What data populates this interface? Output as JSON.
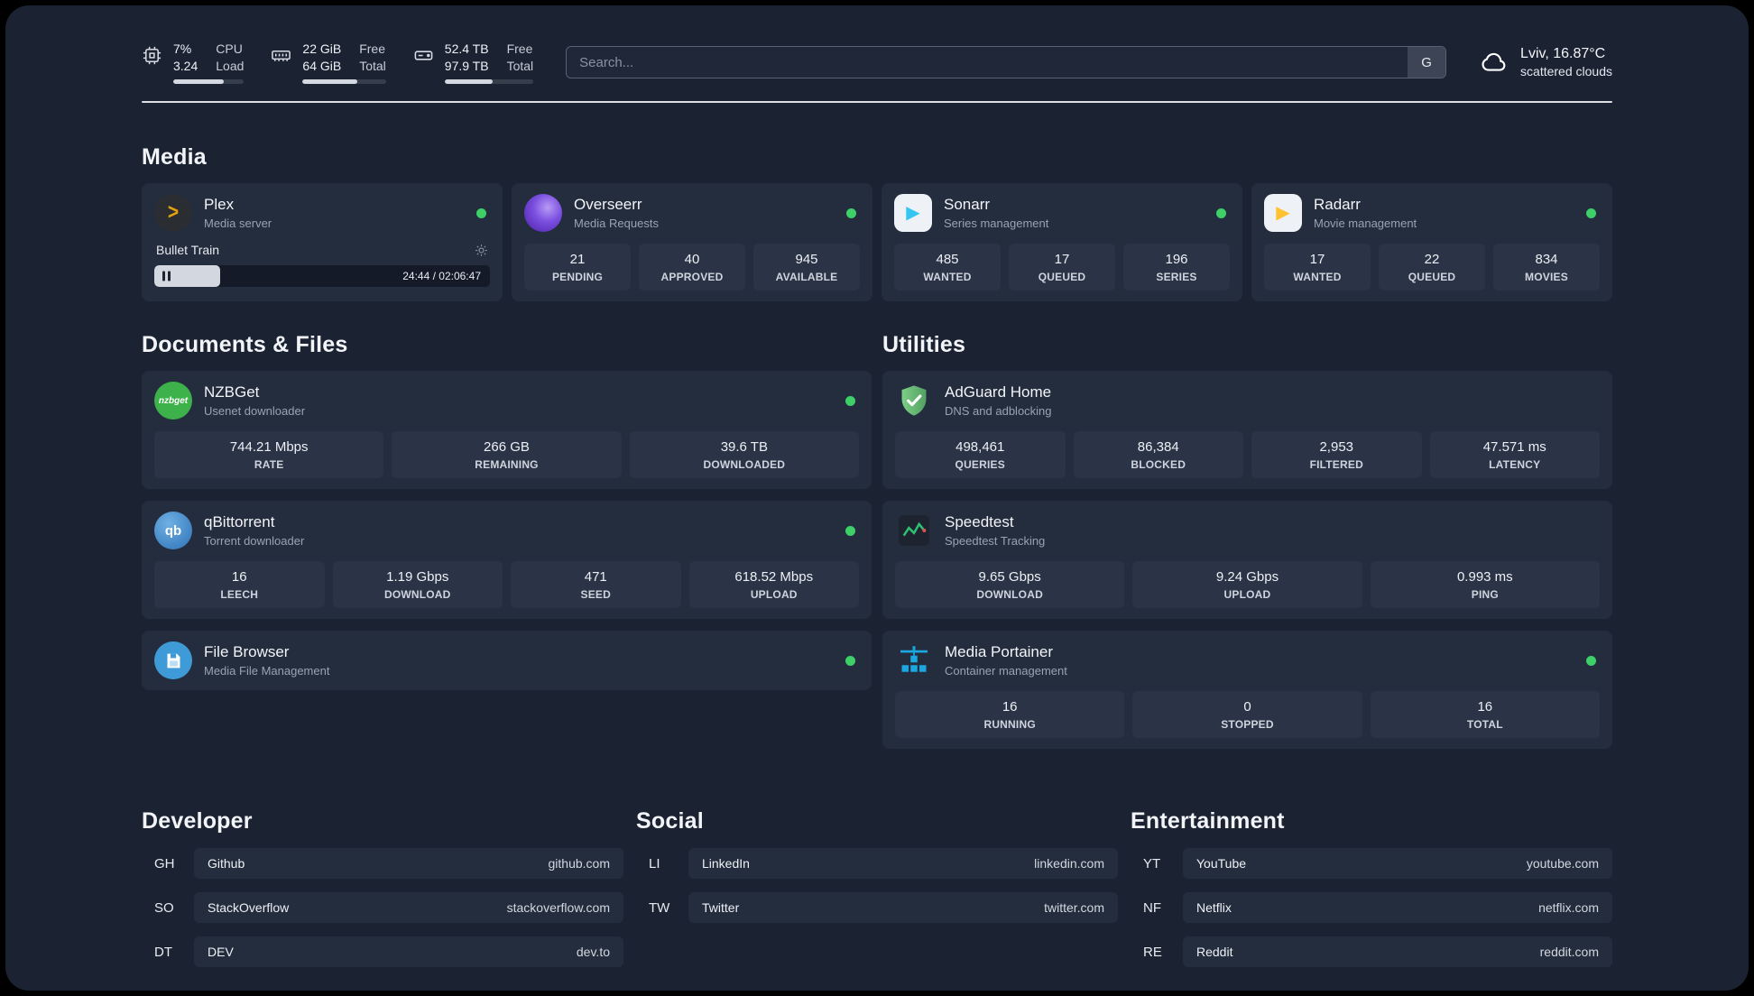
{
  "header": {
    "cpu": {
      "value": "7%",
      "sub": "3.24",
      "label_top": "CPU",
      "label_bottom": "Load",
      "progress_pct": 72
    },
    "ram": {
      "value": "22 GiB",
      "sub": "64 GiB",
      "label_top": "Free",
      "label_bottom": "Total",
      "progress_pct": 66
    },
    "disk": {
      "value": "52.4 TB",
      "sub": "97.9 TB",
      "label_top": "Free",
      "label_bottom": "Total",
      "progress_pct": 54
    },
    "search": {
      "placeholder": "Search...",
      "button_label": "G"
    },
    "weather": {
      "location": "Lviv, 16.87°C",
      "condition": "scattered clouds"
    }
  },
  "sections": {
    "media": {
      "title": "Media",
      "plex": {
        "name": "Plex",
        "description": "Media server",
        "now_playing": "Bullet Train",
        "time_display": "24:44 / 02:06:47",
        "progress_pct": 19.5
      },
      "overseerr": {
        "name": "Overseerr",
        "description": "Media Requests",
        "stats": [
          {
            "value": "21",
            "label": "PENDING"
          },
          {
            "value": "40",
            "label": "APPROVED"
          },
          {
            "value": "945",
            "label": "AVAILABLE"
          }
        ]
      },
      "sonarr": {
        "name": "Sonarr",
        "description": "Series management",
        "stats": [
          {
            "value": "485",
            "label": "WANTED"
          },
          {
            "value": "17",
            "label": "QUEUED"
          },
          {
            "value": "196",
            "label": "SERIES"
          }
        ]
      },
      "radarr": {
        "name": "Radarr",
        "description": "Movie management",
        "stats": [
          {
            "value": "17",
            "label": "WANTED"
          },
          {
            "value": "22",
            "label": "QUEUED"
          },
          {
            "value": "834",
            "label": "MOVIES"
          }
        ]
      }
    },
    "documents": {
      "title": "Documents & Files",
      "nzbget": {
        "name": "NZBGet",
        "description": "Usenet downloader",
        "stats": [
          {
            "value": "744.21 Mbps",
            "label": "RATE"
          },
          {
            "value": "266 GB",
            "label": "REMAINING"
          },
          {
            "value": "39.6 TB",
            "label": "DOWNLOADED"
          }
        ]
      },
      "qbittorrent": {
        "name": "qBittorrent",
        "description": "Torrent downloader",
        "stats": [
          {
            "value": "16",
            "label": "LEECH"
          },
          {
            "value": "1.19 Gbps",
            "label": "DOWNLOAD"
          },
          {
            "value": "471",
            "label": "SEED"
          },
          {
            "value": "618.52 Mbps",
            "label": "UPLOAD"
          }
        ]
      },
      "filebrowser": {
        "name": "File Browser",
        "description": "Media File Management"
      }
    },
    "utilities": {
      "title": "Utilities",
      "adguard": {
        "name": "AdGuard Home",
        "description": "DNS and adblocking",
        "stats": [
          {
            "value": "498,461",
            "label": "QUERIES"
          },
          {
            "value": "86,384",
            "label": "BLOCKED"
          },
          {
            "value": "2,953",
            "label": "FILTERED"
          },
          {
            "value": "47.571 ms",
            "label": "LATENCY"
          }
        ]
      },
      "speedtest": {
        "name": "Speedtest",
        "description": "Speedtest Tracking",
        "stats": [
          {
            "value": "9.65 Gbps",
            "label": "DOWNLOAD"
          },
          {
            "value": "9.24 Gbps",
            "label": "UPLOAD"
          },
          {
            "value": "0.993 ms",
            "label": "PING"
          }
        ]
      },
      "portainer": {
        "name": "Media Portainer",
        "description": "Container management",
        "stats": [
          {
            "value": "16",
            "label": "RUNNING"
          },
          {
            "value": "0",
            "label": "STOPPED"
          },
          {
            "value": "16",
            "label": "TOTAL"
          }
        ]
      }
    }
  },
  "bookmarks": {
    "developer": {
      "title": "Developer",
      "items": [
        {
          "abbr": "GH",
          "name": "Github",
          "url": "github.com"
        },
        {
          "abbr": "SO",
          "name": "StackOverflow",
          "url": "stackoverflow.com"
        },
        {
          "abbr": "DT",
          "name": "DEV",
          "url": "dev.to"
        }
      ]
    },
    "social": {
      "title": "Social",
      "items": [
        {
          "abbr": "LI",
          "name": "LinkedIn",
          "url": "linkedin.com"
        },
        {
          "abbr": "TW",
          "name": "Twitter",
          "url": "twitter.com"
        }
      ]
    },
    "entertainment": {
      "title": "Entertainment",
      "items": [
        {
          "abbr": "YT",
          "name": "YouTube",
          "url": "youtube.com"
        },
        {
          "abbr": "NF",
          "name": "Netflix",
          "url": "netflix.com"
        },
        {
          "abbr": "RE",
          "name": "Reddit",
          "url": "reddit.com"
        }
      ]
    }
  },
  "nzbget_logo_text": "nzbget",
  "qbittorrent_logo_text": "qb",
  "icons": {
    "plex_chevron": ">",
    "sonarr_play": "▶",
    "radarr_play": "▶"
  },
  "colors": {
    "status_online": "#3ecf68",
    "plex_gold": "#e5a00d",
    "sonarr_blue": "#35c5f1",
    "radarr_amber": "#ffc230",
    "nzbget_green": "#3db14a",
    "filebrowser_blue": "#3f9ad8",
    "adguard_green": "#67b279",
    "portainer_blue": "#1ba7e0",
    "speedtest_green": "#2fbf71"
  }
}
